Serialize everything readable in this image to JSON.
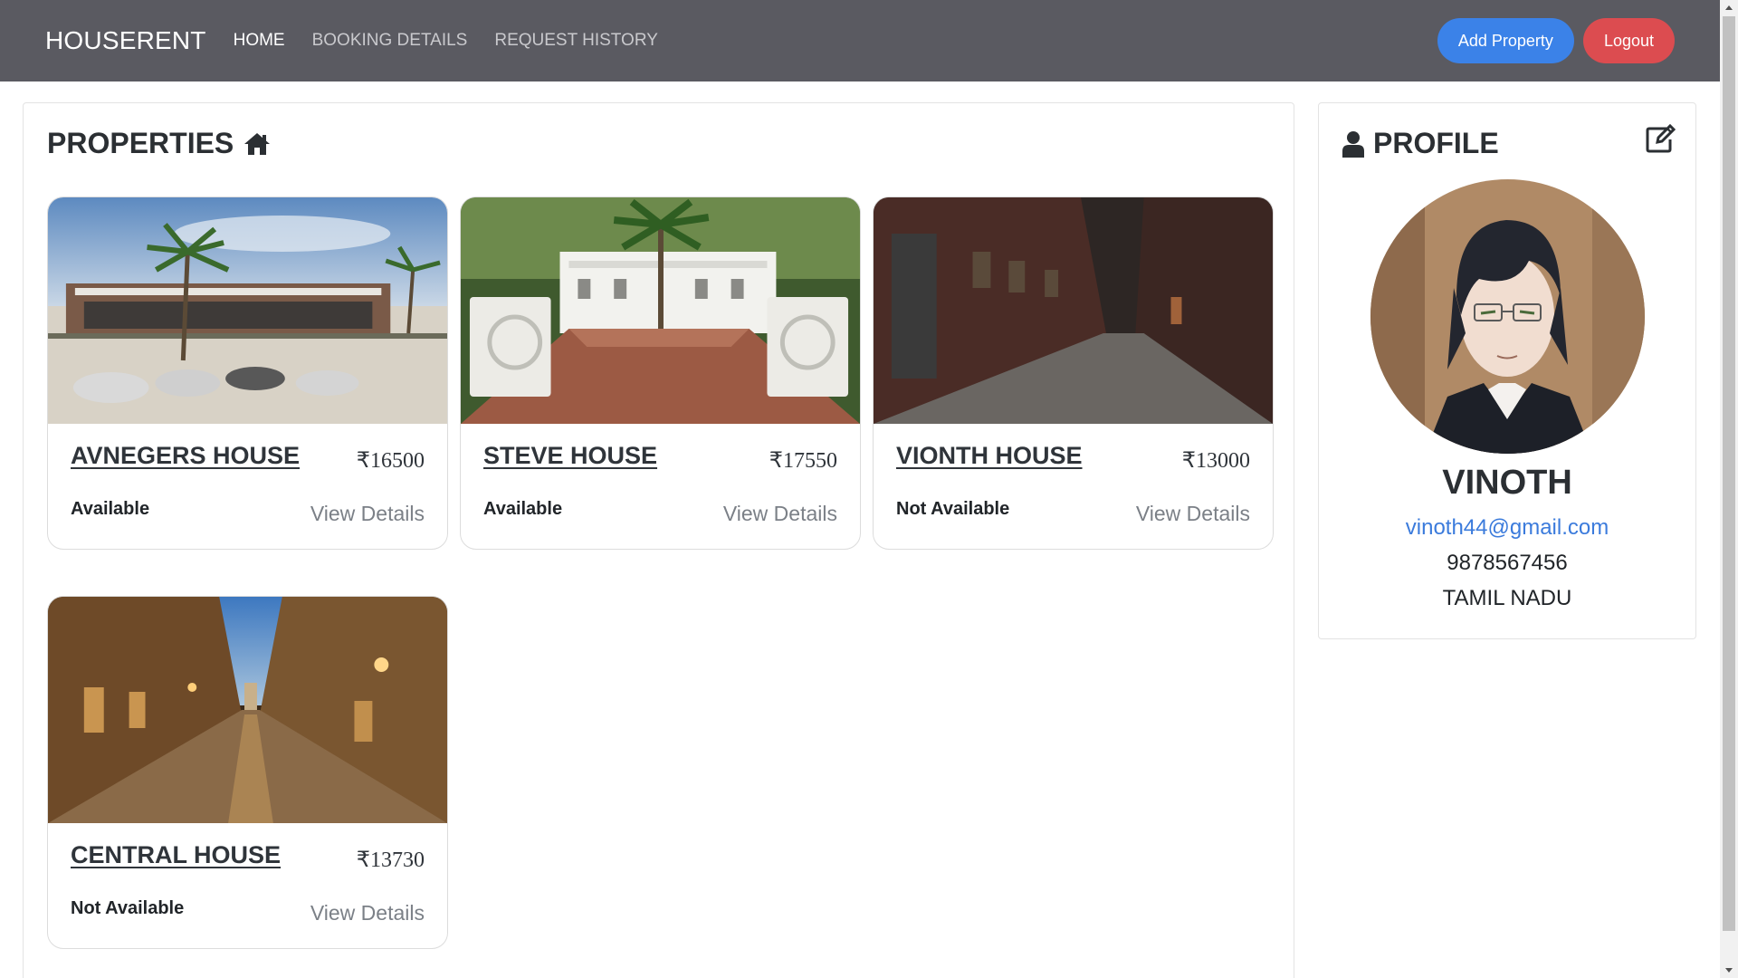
{
  "nav": {
    "brand": "HOUSERENT",
    "links": [
      "HOME",
      "BOOKING DETAILS",
      "REQUEST HISTORY"
    ],
    "add_property": "Add Property",
    "logout": "Logout"
  },
  "properties": {
    "title": "PROPERTIES",
    "title_icon": "home-icon",
    "items": [
      {
        "name": "AVNEGERS HOUSE",
        "price": "₹16500",
        "status": "Available",
        "view": "View Details"
      },
      {
        "name": "STEVE HOUSE",
        "price": "₹17550",
        "status": "Available",
        "view": "View Details"
      },
      {
        "name": "VIONTH HOUSE",
        "price": "₹13000",
        "status": "Not Available",
        "view": "View Details"
      },
      {
        "name": "CENTRAL HOUSE",
        "price": "₹13730",
        "status": "Not Available",
        "view": "View Details"
      }
    ]
  },
  "profile": {
    "title": "PROFILE",
    "title_icon": "user-icon",
    "edit_icon": "edit-icon",
    "name": "VINOTH",
    "email": "vinoth44@gmail.com",
    "phone": "9878567456",
    "state": "TAMIL NADU"
  },
  "colors": {
    "navbar": "#5a5a61",
    "primary": "#3b82e8",
    "danger": "#dc4c50",
    "link": "#3b7bdc"
  }
}
